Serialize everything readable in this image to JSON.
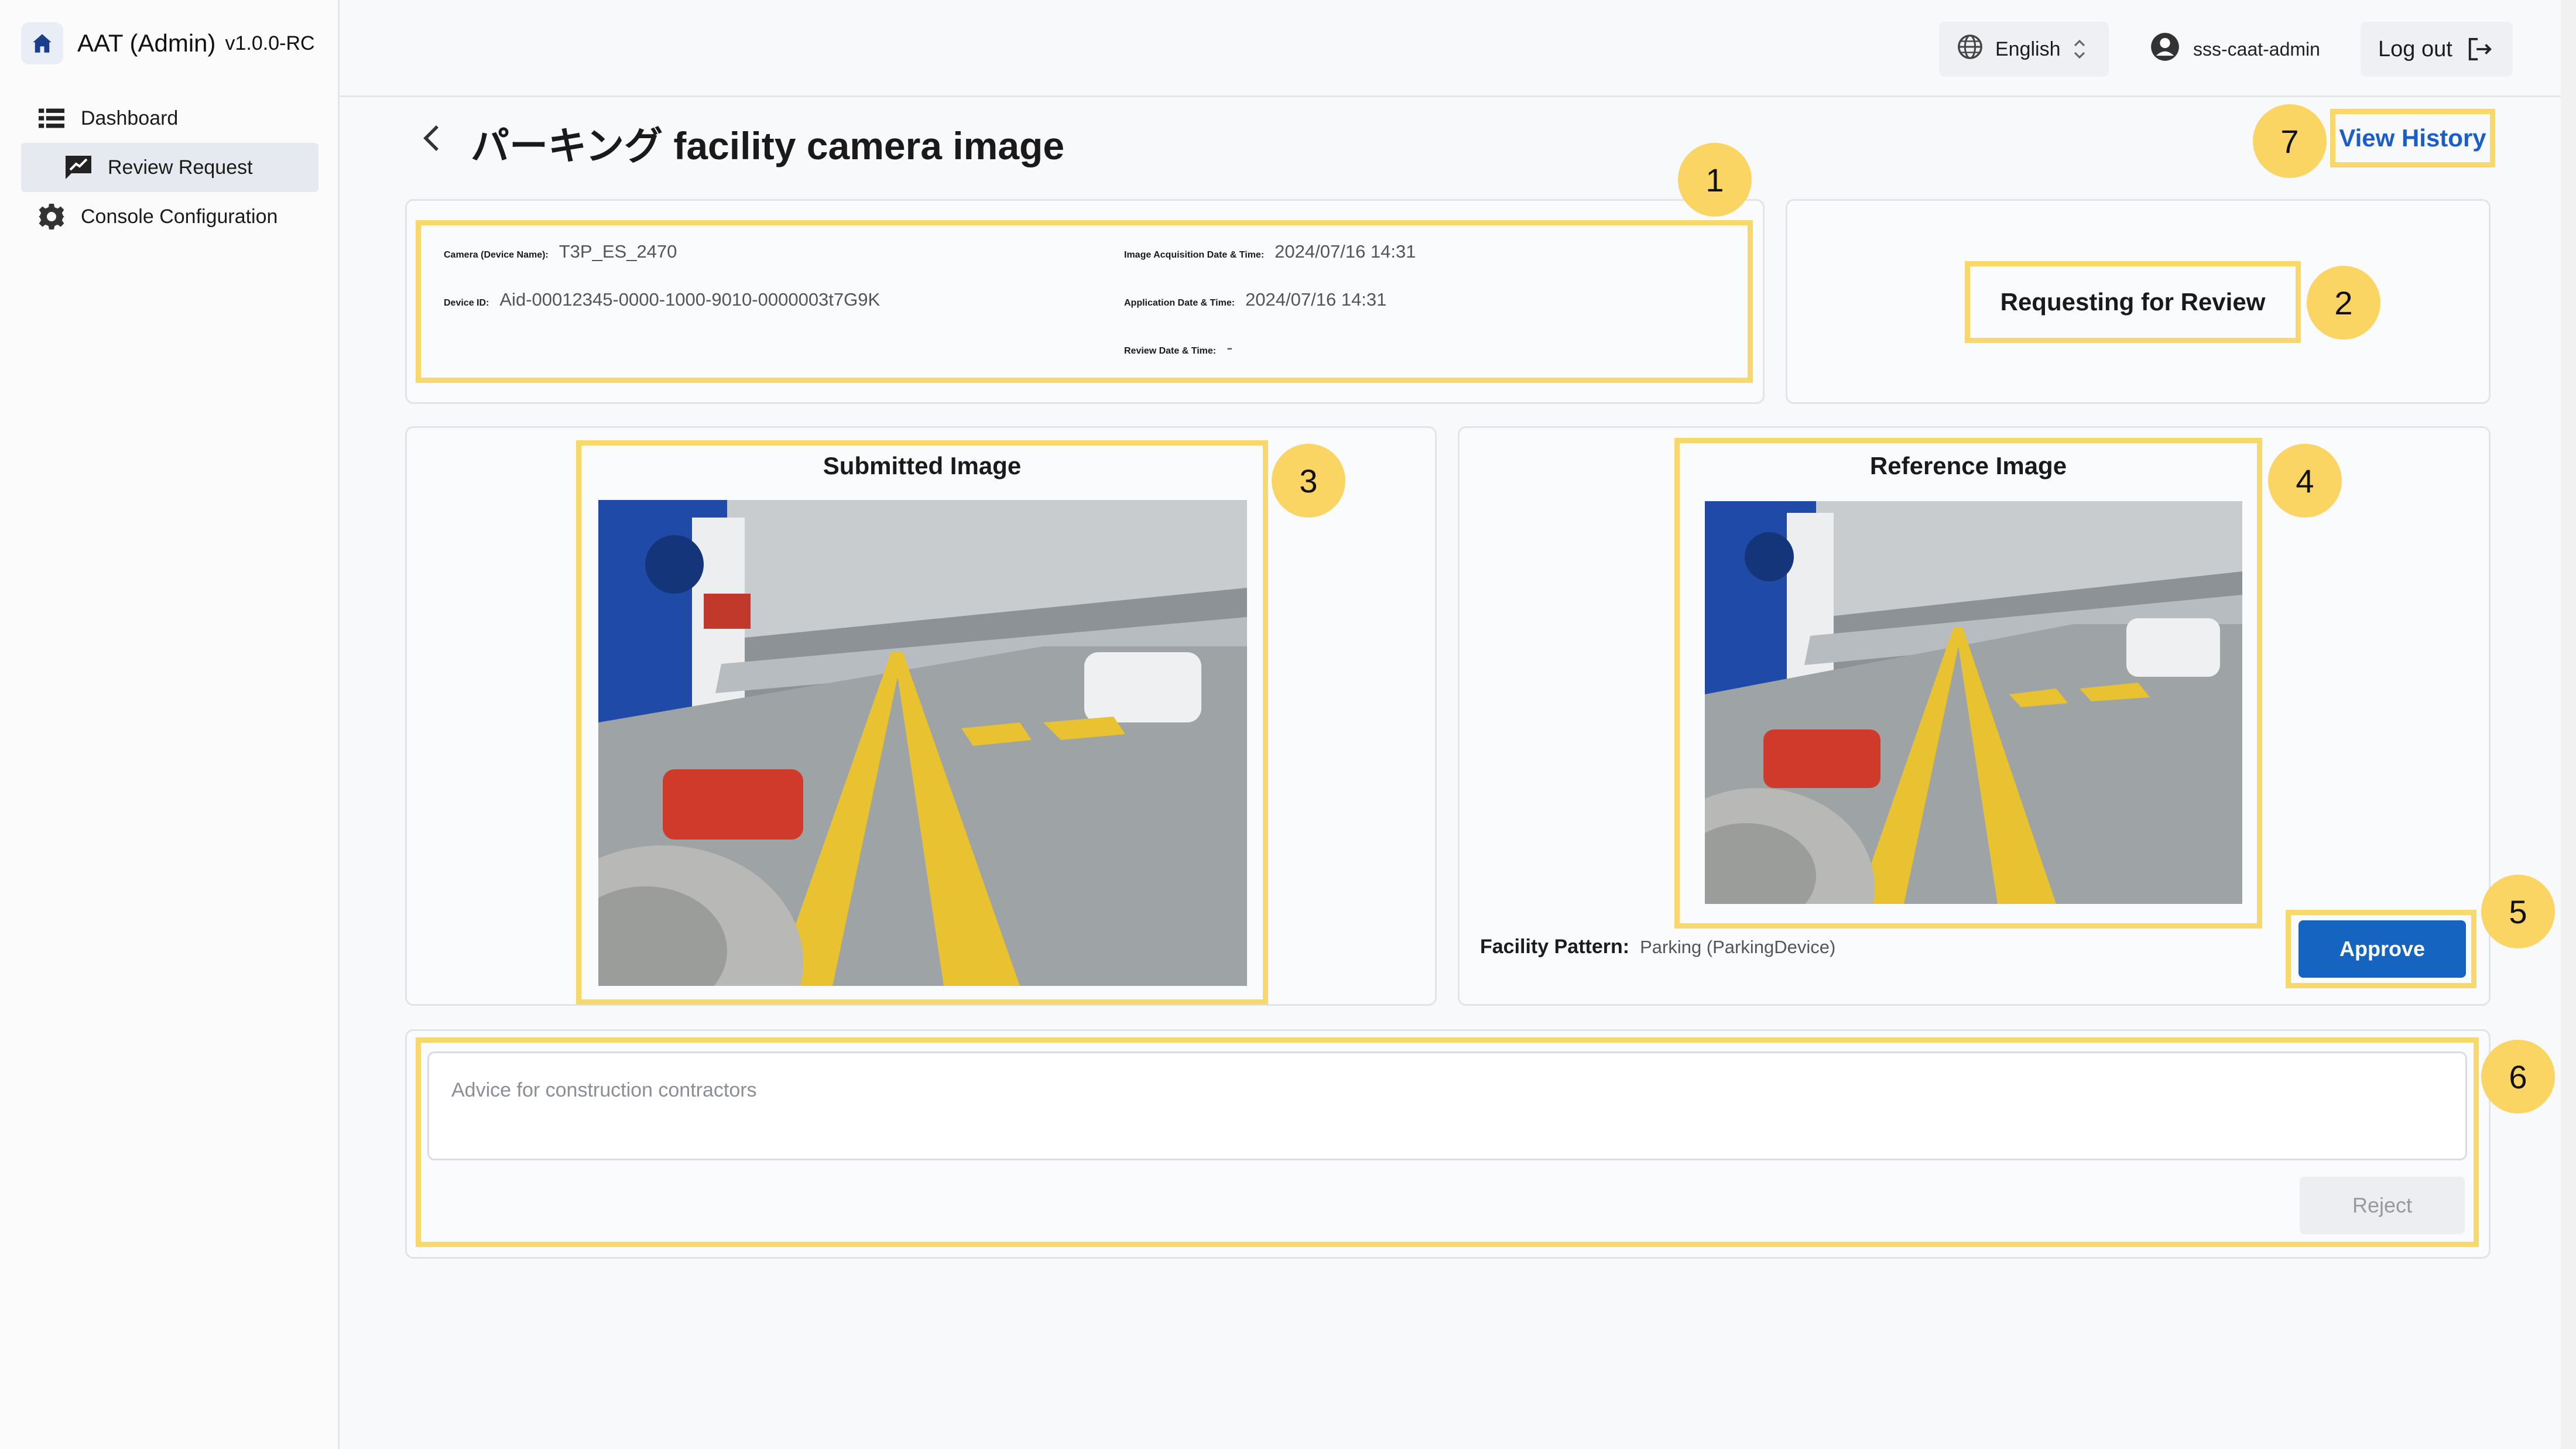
{
  "app": {
    "title": "AAT (Admin)",
    "version": "v1.0.0-RC"
  },
  "sidebar": {
    "items": [
      {
        "label": "Dashboard",
        "icon": "list-icon"
      },
      {
        "label": "Review Request",
        "icon": "review-icon",
        "active": true
      },
      {
        "label": "Console Configuration",
        "icon": "gear-icon"
      }
    ]
  },
  "topbar": {
    "language": "English",
    "user": "sss-caat-admin",
    "logout": "Log out"
  },
  "page": {
    "title": "パーキング facility camera image",
    "history_link": "View History"
  },
  "details": {
    "camera_label": "Camera (Device Name):",
    "camera_value": "T3P_ES_2470",
    "device_label": "Device ID:",
    "device_value": "Aid-00012345-0000-1000-9010-0000003t7G9K",
    "acq_label": "Image Acquisition Date & Time:",
    "acq_value": "2024/07/16 14:31",
    "app_label": "Application Date & Time:",
    "app_value": "2024/07/16 14:31",
    "review_label": "Review Date & Time:",
    "review_value": "-"
  },
  "status": {
    "text": "Requesting for Review"
  },
  "submitted": {
    "title": "Submitted Image"
  },
  "reference": {
    "title": "Reference Image"
  },
  "pattern": {
    "label": "Facility Pattern:",
    "value": "Parking (ParkingDevice)"
  },
  "actions": {
    "approve": "Approve",
    "reject": "Reject",
    "advice_placeholder": "Advice for construction contractors"
  },
  "badges": [
    "1",
    "2",
    "3",
    "4",
    "5",
    "6",
    "7"
  ],
  "colors": {
    "accent": "#1565c0",
    "highlight": "#f8d76b",
    "badge": "#fad564",
    "link": "#1b5ec9"
  }
}
